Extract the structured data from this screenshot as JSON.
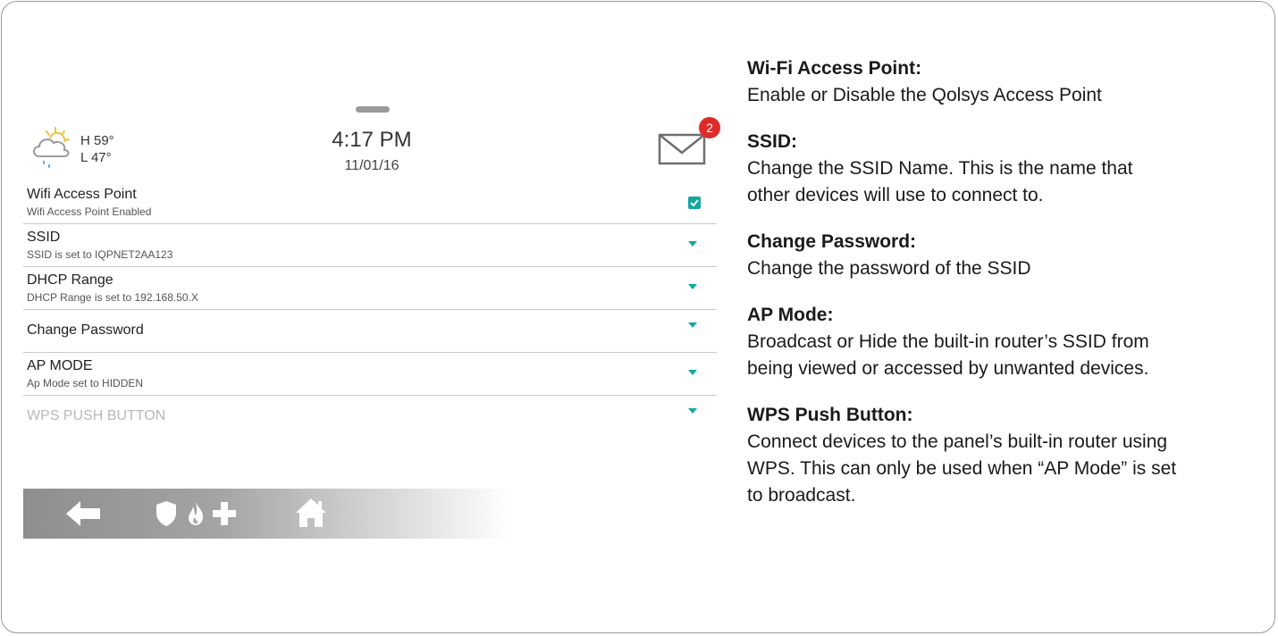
{
  "status_bar": {
    "weather": {
      "high": "H 59°",
      "low": "L 47°",
      "icon": "cloud-sun-rain-icon"
    },
    "time": "4:17 PM",
    "date": "11/01/16",
    "messages": {
      "count": "2",
      "icon": "mail-icon"
    }
  },
  "settings": [
    {
      "title": "Wifi Access Point",
      "subtitle": "Wifi Access Point Enabled",
      "control": "checkbox",
      "checked": true
    },
    {
      "title": "SSID",
      "subtitle": "SSID is set to IQPNET2AA123",
      "control": "dropdown"
    },
    {
      "title": "DHCP Range",
      "subtitle": "DHCP Range is set to 192.168.50.X",
      "control": "dropdown"
    },
    {
      "title": "Change Password",
      "subtitle": "",
      "control": "dropdown"
    },
    {
      "title": "AP MODE",
      "subtitle": "Ap Mode set to HIDDEN",
      "control": "dropdown"
    },
    {
      "title": "WPS PUSH BUTTON",
      "subtitle": "",
      "control": "dropdown",
      "disabled": true
    }
  ],
  "nav_bar": {
    "icons": [
      "back-arrow-icon",
      "shield-icon",
      "fire-icon",
      "plus-icon",
      "home-icon"
    ]
  },
  "help": [
    {
      "heading": "Wi-Fi Access Point:",
      "lines": [
        "Enable or Disable the Qolsys Access Point"
      ]
    },
    {
      "heading": "SSID:",
      "lines": [
        "Change the SSID Name. This is the name that",
        "other devices will use to connect to."
      ]
    },
    {
      "heading": "Change Password:",
      "lines": [
        "Change the password of the SSID"
      ]
    },
    {
      "heading": "AP Mode:",
      "lines": [
        "Broadcast or Hide the built-in router’s SSID from",
        "being viewed or accessed by unwanted devices."
      ]
    },
    {
      "heading": "WPS Push Button:",
      "lines": [
        "Connect devices to the panel’s built-in router using",
        "WPS. This can only be used when “AP Mode” is set",
        "to broadcast."
      ]
    }
  ],
  "colors": {
    "accent": "#13a89e",
    "badge": "#e02a2a",
    "disabled_text": "#b8b8b8"
  }
}
